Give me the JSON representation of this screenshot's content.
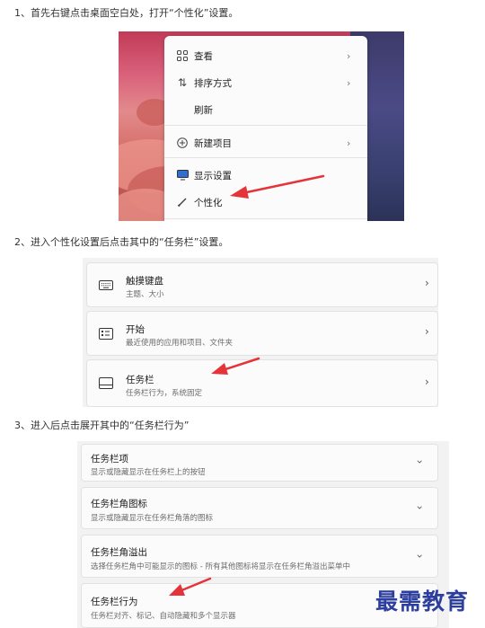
{
  "steps": [
    "1、首先右键点击桌面空白处，打开“个性化”设置。",
    "2、进入个性化设置后点击其中的“任务栏”设置。",
    "3、进入后点击展开其中的“任务栏行为”"
  ],
  "context_menu": {
    "view": "查看",
    "sort": "排序方式",
    "refresh": "刷新",
    "new": "新建项目",
    "display": "显示设置",
    "personalize": "个性化"
  },
  "settings_cards": [
    {
      "title": "触摸键盘",
      "subtitle": "主题、大小",
      "icon": "keyboard-icon"
    },
    {
      "title": "开始",
      "subtitle": "最近使用的应用和项目、文件夹",
      "icon": "start-icon"
    },
    {
      "title": "任务栏",
      "subtitle": "任务栏行为，系统固定",
      "icon": "taskbar-icon"
    }
  ],
  "taskbar_sections": [
    {
      "title": "任务栏项",
      "subtitle": "显示或隐藏显示在任务栏上的按钮"
    },
    {
      "title": "任务栏角图标",
      "subtitle": "显示或隐藏显示在任务栏角落的图标"
    },
    {
      "title": "任务栏角溢出",
      "subtitle": "选择任务栏角中可能显示的图标 - 所有其他图标将显示在任务栏角溢出菜单中"
    },
    {
      "title": "任务栏行为",
      "subtitle": "任务栏对齐、标记、自动隐藏和多个显示器"
    }
  ],
  "watermark": "最需教育",
  "colors": {
    "arrow": "#e5333a",
    "watermark": "#2d3f9e"
  }
}
